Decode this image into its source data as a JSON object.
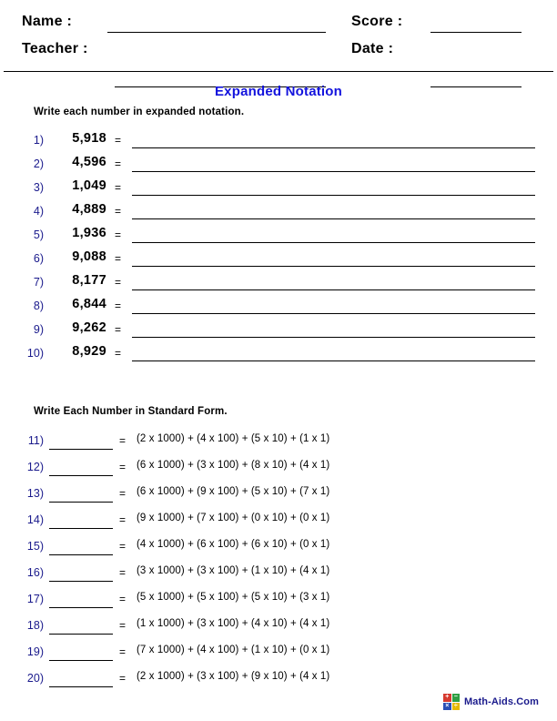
{
  "header": {
    "name_label": "Name :",
    "teacher_label": "Teacher :",
    "score_label": "Score :",
    "date_label": "Date :",
    "name_value": "",
    "teacher_value": "",
    "score_value": "",
    "date_value": ""
  },
  "title": "Expanded Notation",
  "section1": {
    "instruction": "Write each number in expanded notation.",
    "items": [
      {
        "num": "1)",
        "value": "5,918",
        "eq": "=",
        "answer": ""
      },
      {
        "num": "2)",
        "value": "4,596",
        "eq": "=",
        "answer": ""
      },
      {
        "num": "3)",
        "value": "1,049",
        "eq": "=",
        "answer": ""
      },
      {
        "num": "4)",
        "value": "4,889",
        "eq": "=",
        "answer": ""
      },
      {
        "num": "5)",
        "value": "1,936",
        "eq": "=",
        "answer": ""
      },
      {
        "num": "6)",
        "value": "9,088",
        "eq": "=",
        "answer": ""
      },
      {
        "num": "7)",
        "value": "8,177",
        "eq": "=",
        "answer": ""
      },
      {
        "num": "8)",
        "value": "6,844",
        "eq": "=",
        "answer": ""
      },
      {
        "num": "9)",
        "value": "9,262",
        "eq": "=",
        "answer": ""
      },
      {
        "num": "10)",
        "value": "8,929",
        "eq": "=",
        "answer": ""
      }
    ]
  },
  "section2": {
    "instruction": "Write Each Number in Standard Form.",
    "items": [
      {
        "num": "11)",
        "answer": "",
        "eq": "=",
        "expression": "(2 x 1000) + (4 x 100) + (5 x 10) + (1 x 1)"
      },
      {
        "num": "12)",
        "answer": "",
        "eq": "=",
        "expression": "(6 x 1000) + (3 x 100) + (8 x 10) + (4 x 1)"
      },
      {
        "num": "13)",
        "answer": "",
        "eq": "=",
        "expression": "(6 x 1000) + (9 x 100) + (5 x 10) + (7 x 1)"
      },
      {
        "num": "14)",
        "answer": "",
        "eq": "=",
        "expression": "(9 x 1000) + (7 x 100) + (0 x 10) + (0 x 1)"
      },
      {
        "num": "15)",
        "answer": "",
        "eq": "=",
        "expression": "(4 x 1000) + (6 x 100) + (6 x 10) + (0 x 1)"
      },
      {
        "num": "16)",
        "answer": "",
        "eq": "=",
        "expression": "(3 x 1000) + (3 x 100) + (1 x 10) + (4 x 1)"
      },
      {
        "num": "17)",
        "answer": "",
        "eq": "=",
        "expression": "(5 x 1000) + (5 x 100) + (5 x 10) + (3 x 1)"
      },
      {
        "num": "18)",
        "answer": "",
        "eq": "=",
        "expression": "(1 x 1000) + (3 x 100) + (4 x 10) + (4 x 1)"
      },
      {
        "num": "19)",
        "answer": "",
        "eq": "=",
        "expression": "(7 x 1000) + (4 x 100) + (1 x 10) + (0 x 1)"
      },
      {
        "num": "20)",
        "answer": "",
        "eq": "=",
        "expression": "(2 x 1000) + (3 x 100) + (9 x 10) + (4 x 1)"
      }
    ]
  },
  "footer": {
    "logo_text": "Math-Aids.Com",
    "logo_icon": "math-symbols-grid-icon",
    "logo_symbols": [
      "+",
      "−",
      "×",
      "÷"
    ]
  },
  "colors": {
    "title_blue": "#1212dd",
    "number_navy": "#1a1a8c",
    "text_black": "#000000"
  }
}
